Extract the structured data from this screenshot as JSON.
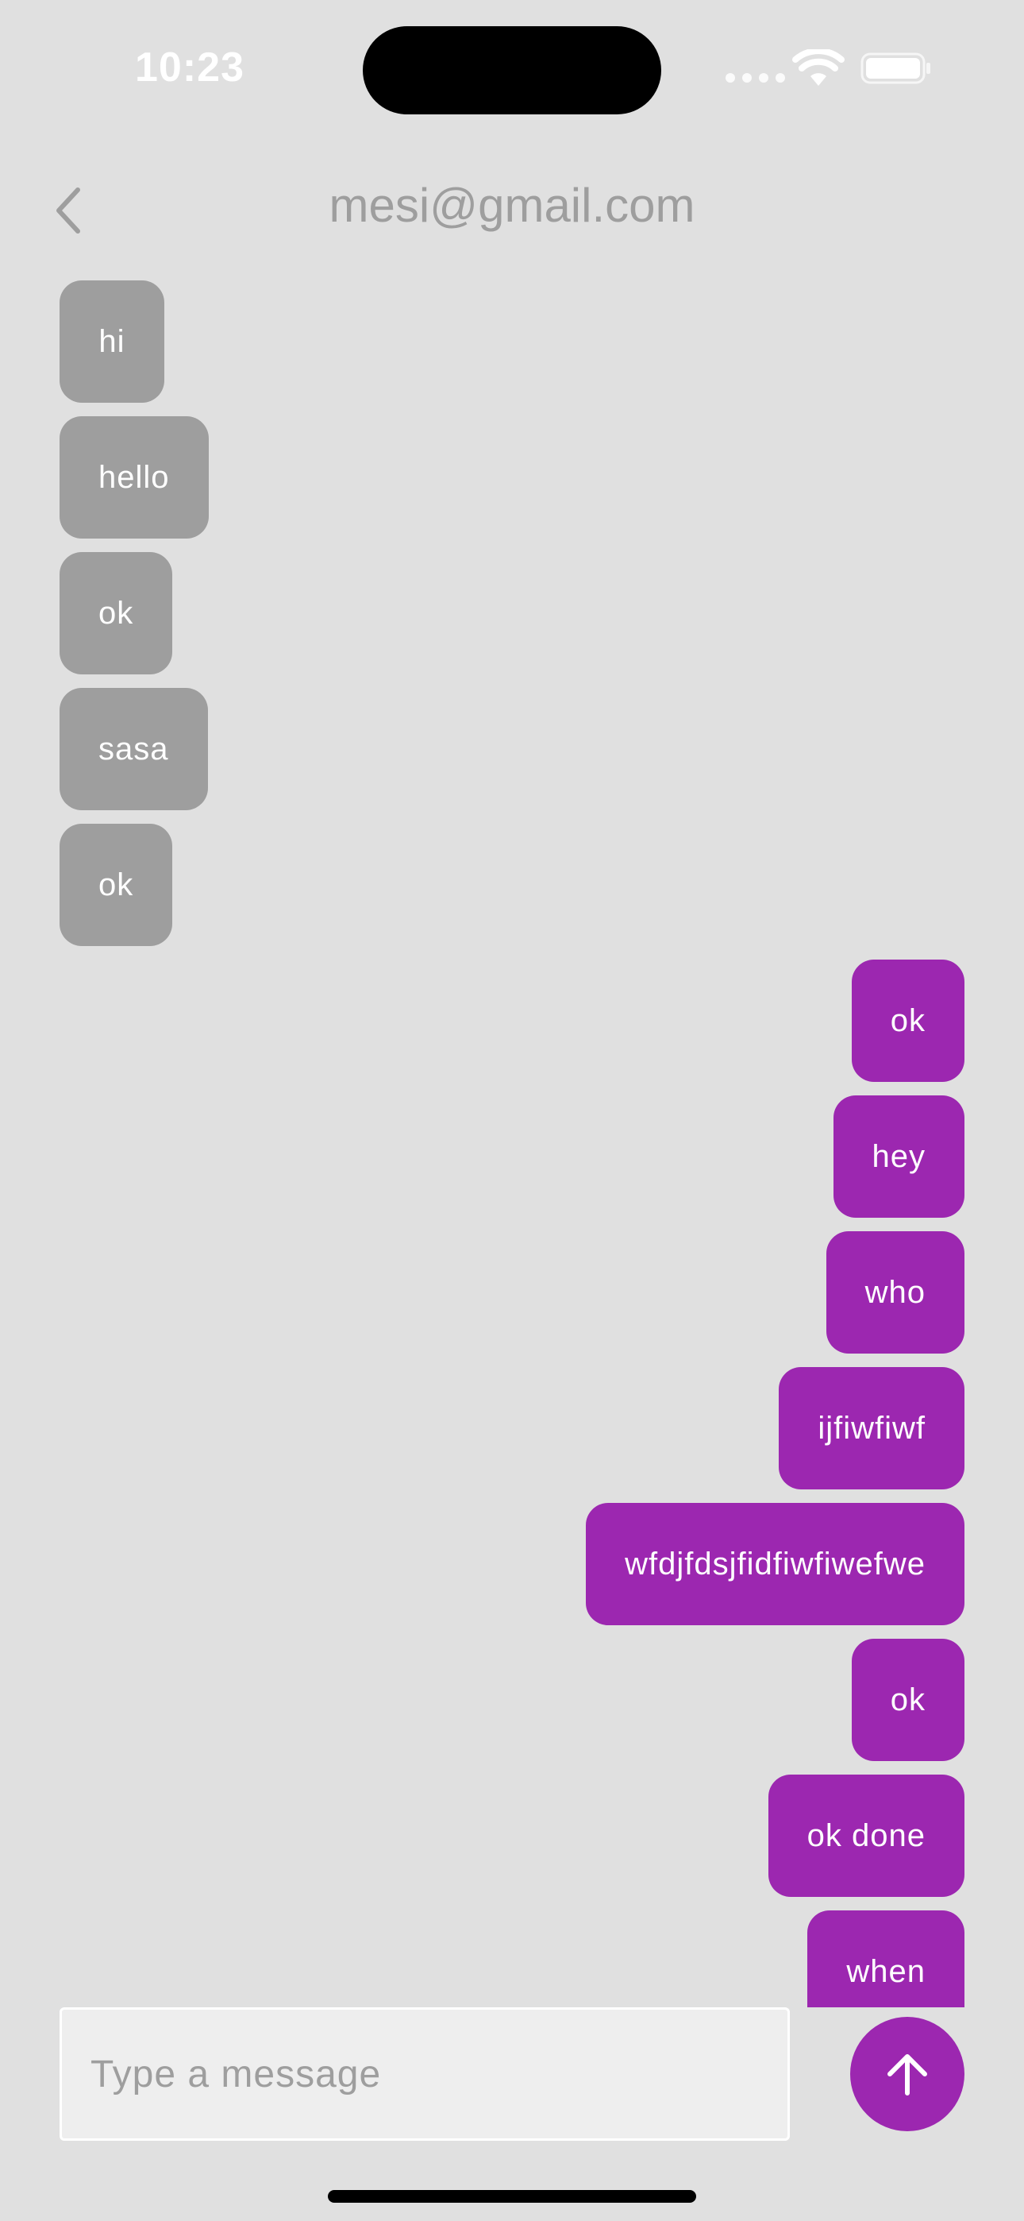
{
  "status_bar": {
    "time": "10:23"
  },
  "header": {
    "title": "mesi@gmail.com",
    "back_icon": "chevron-left-icon"
  },
  "messages": [
    {
      "text": "hi",
      "direction": "received"
    },
    {
      "text": "hello",
      "direction": "received"
    },
    {
      "text": "ok",
      "direction": "received"
    },
    {
      "text": "sasa",
      "direction": "received"
    },
    {
      "text": "ok",
      "direction": "received"
    },
    {
      "text": "ok",
      "direction": "sent"
    },
    {
      "text": "hey",
      "direction": "sent"
    },
    {
      "text": "who",
      "direction": "sent"
    },
    {
      "text": "ijfiwfiwf",
      "direction": "sent"
    },
    {
      "text": "wfdjfdsjfidfiwfiwefwe",
      "direction": "sent"
    },
    {
      "text": "ok",
      "direction": "sent"
    },
    {
      "text": "ok done",
      "direction": "sent"
    },
    {
      "text": "when",
      "direction": "sent"
    }
  ],
  "composer": {
    "placeholder": "Type a message",
    "value": "",
    "send_icon": "arrow-up-icon"
  },
  "colors": {
    "background": "#e0e0e0",
    "received_bubble": "#9e9e9e",
    "sent_bubble": "#9c27b0",
    "title_text": "#9e9e9e"
  }
}
